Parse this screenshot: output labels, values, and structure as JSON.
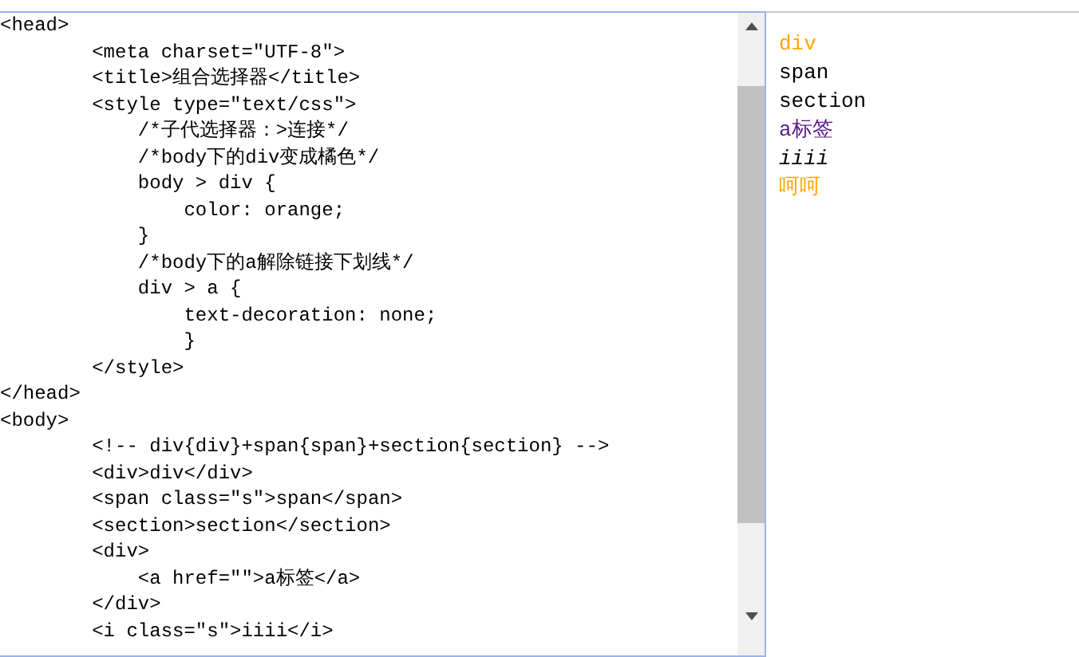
{
  "code_editor": {
    "lines": [
      "<head>",
      "        <meta charset=\"UTF-8\">",
      "        <title>组合选择器</title>",
      "        <style type=\"text/css\">",
      "            /*子代选择器：>连接*/",
      "            /*body下的div变成橘色*/",
      "            body > div {",
      "                color: orange;",
      "            }",
      "            /*body下的a解除链接下划线*/",
      "            div > a {",
      "                text-decoration: none;",
      "                }",
      "        </style>",
      "</head>",
      "<body>",
      "        <!-- div{div}+span{span}+section{section} -->",
      "        <div>div</div>",
      "        <span class=\"s\">span</span>",
      "        <section>section</section>",
      "        <div>",
      "            <a href=\"\">a标签</a>",
      "        </div>",
      "        <i class=\"s\">iiii</i>"
    ]
  },
  "preview": {
    "items": [
      {
        "text": "div",
        "color": "#ffa500",
        "kind": "block"
      },
      {
        "text": "span",
        "color": "#000000",
        "kind": "block"
      },
      {
        "text": "section",
        "color": "#000000",
        "kind": "block"
      },
      {
        "text": "a标签",
        "color": "#551a8b",
        "kind": "link"
      },
      {
        "text": "iiii",
        "color": "#000000",
        "kind": "italic"
      },
      {
        "text": "呵呵",
        "color": "#ffa500",
        "kind": "block"
      }
    ]
  }
}
